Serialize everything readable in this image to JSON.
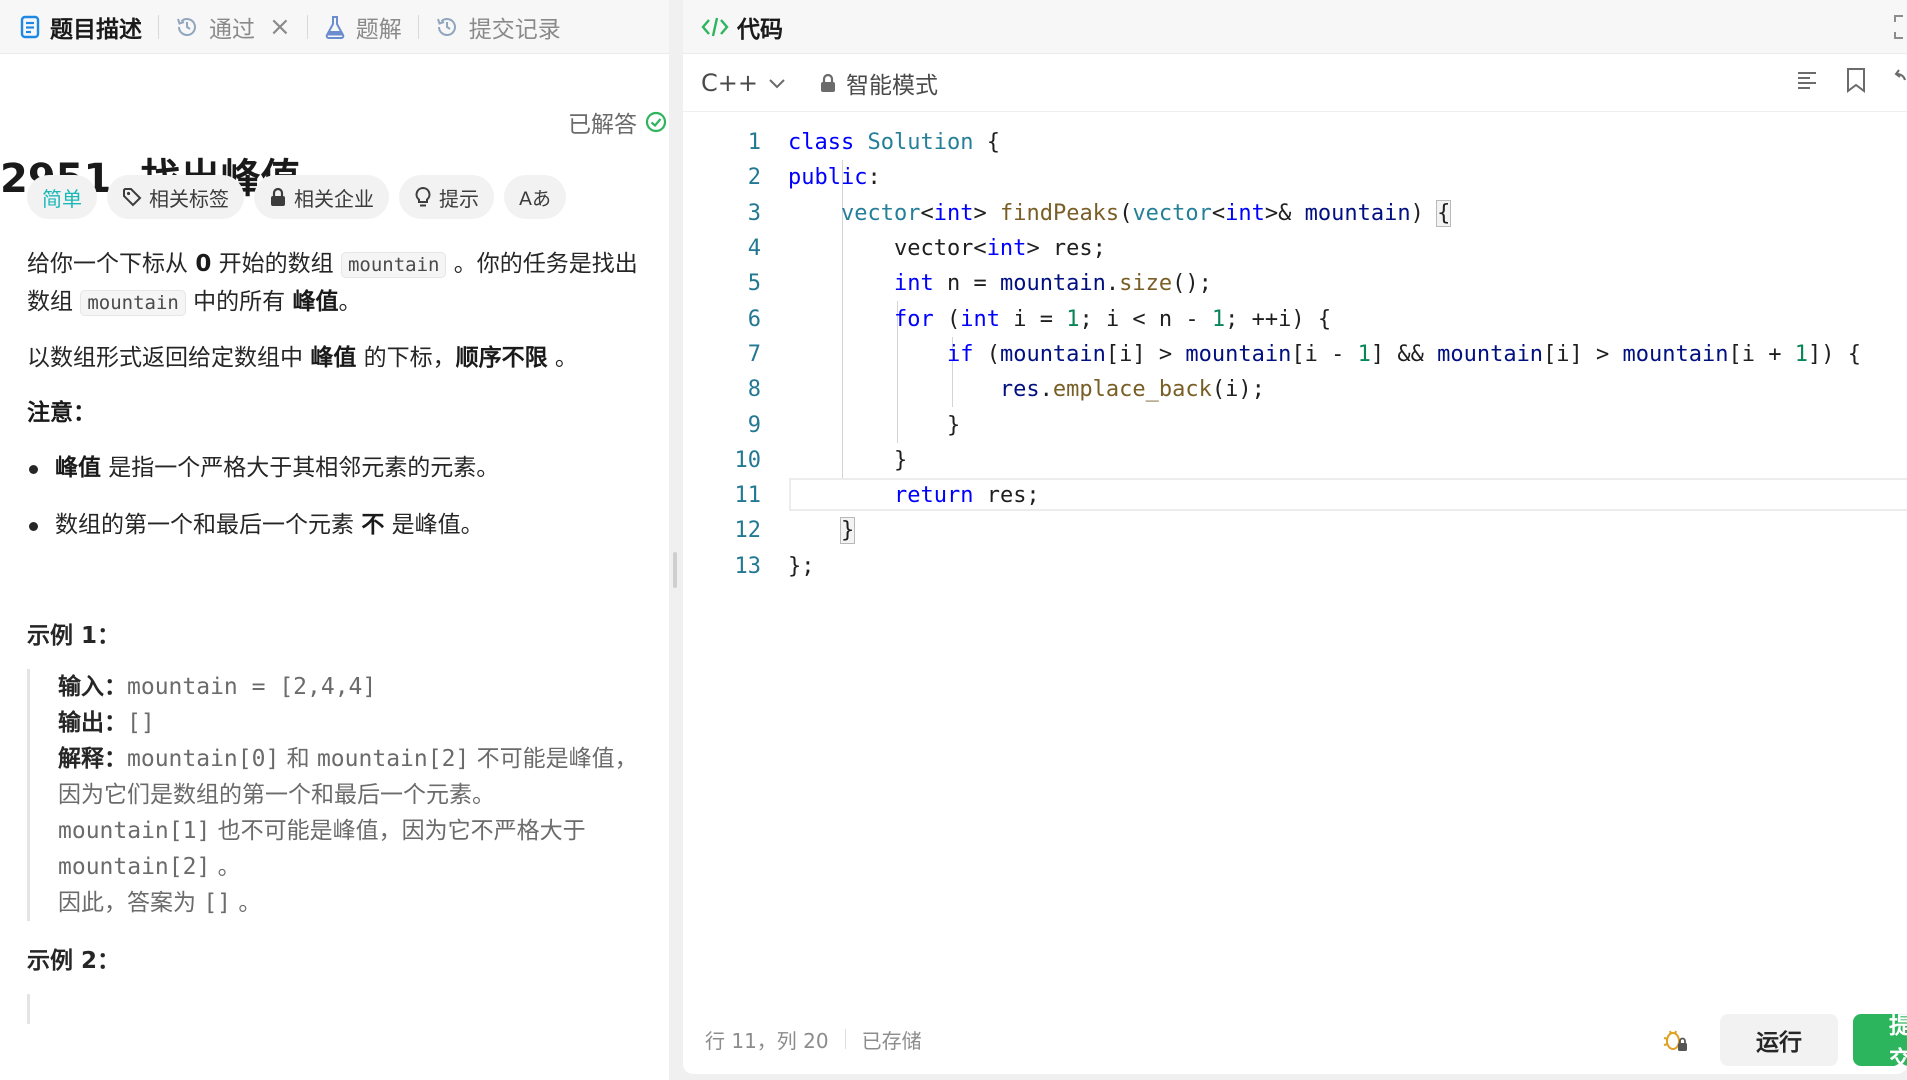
{
  "tabs": {
    "description": "题目描述",
    "accepted": "通过",
    "solutions": "题解",
    "submissions": "提交记录"
  },
  "problem": {
    "title": "2951. 找出峰值",
    "status": "已解答",
    "tags": {
      "difficulty": "简单",
      "topics": "相关标签",
      "companies": "相关企业",
      "hint": "提示",
      "translate": "Aあ"
    },
    "para1": {
      "t1": "给你一个下标从 ",
      "zero": "0",
      "t2": " 开始的数组 ",
      "code1": "mountain",
      "t3": " 。你的任务是找出数组 ",
      "code2": "mountain",
      "t4": " 中的所有 ",
      "peak": "峰值",
      "t5": "。"
    },
    "para2": {
      "t1": "以数组形式返回给定数组中 ",
      "peak": "峰值",
      "t2": " 的下标，",
      "order": "顺序不限",
      "t3": " 。"
    },
    "note_label": "注意：",
    "notes": [
      {
        "bold": "峰值",
        "text": " 是指一个严格大于其相邻元素的元素。"
      },
      {
        "text1": "数组的第一个和最后一个元素 ",
        "bold": "不",
        "text2": " 是峰值。"
      }
    ],
    "example1": {
      "title": "示例 1：",
      "input_label": "输入：",
      "input": "mountain = [2,4,4]",
      "output_label": "输出：",
      "output": "[]",
      "explain_label": "解释：",
      "explain_1a": "mountain[0]",
      "explain_1b": " 和 ",
      "explain_1c": "mountain[2]",
      "explain_1d": " 不可能是峰值，因为它们是数组的第一个和最后一个元素。",
      "explain_2a": "mountain[1]",
      "explain_2b": " 也不可能是峰值，因为它不严格大于 ",
      "explain_2c": "mountain[2]",
      "explain_2d": " 。",
      "explain_3a": "因此，答案为 ",
      "explain_3b": "[]",
      "explain_3c": " 。"
    },
    "example2": {
      "title": "示例 2："
    }
  },
  "editor": {
    "header": "代码",
    "language": "C++",
    "mode": "智能模式",
    "code_lines": [
      "class Solution {",
      "public:",
      "    vector<int> findPeaks(vector<int>& mountain) {",
      "        vector<int> res;",
      "        int n = mountain.size();",
      "        for (int i = 1; i < n - 1; ++i) {",
      "            if (mountain[i] > mountain[i - 1] && mountain[i] > mountain[i + 1]) {",
      "                res.emplace_back(i);",
      "            }",
      "        }",
      "        return res;",
      "    }",
      "};"
    ],
    "cursor_position": "行 11，列 20",
    "save_status": "已存储",
    "run_label": "运行",
    "submit_label": "提交"
  },
  "colors": {
    "easy": "#1cb8b8",
    "solved": "#2db55d",
    "submit": "#2db55d",
    "keyword": "#0000ff",
    "class": "#267f99",
    "function": "#795e26",
    "number": "#098658",
    "variable": "#001080",
    "line_number": "#237893"
  }
}
